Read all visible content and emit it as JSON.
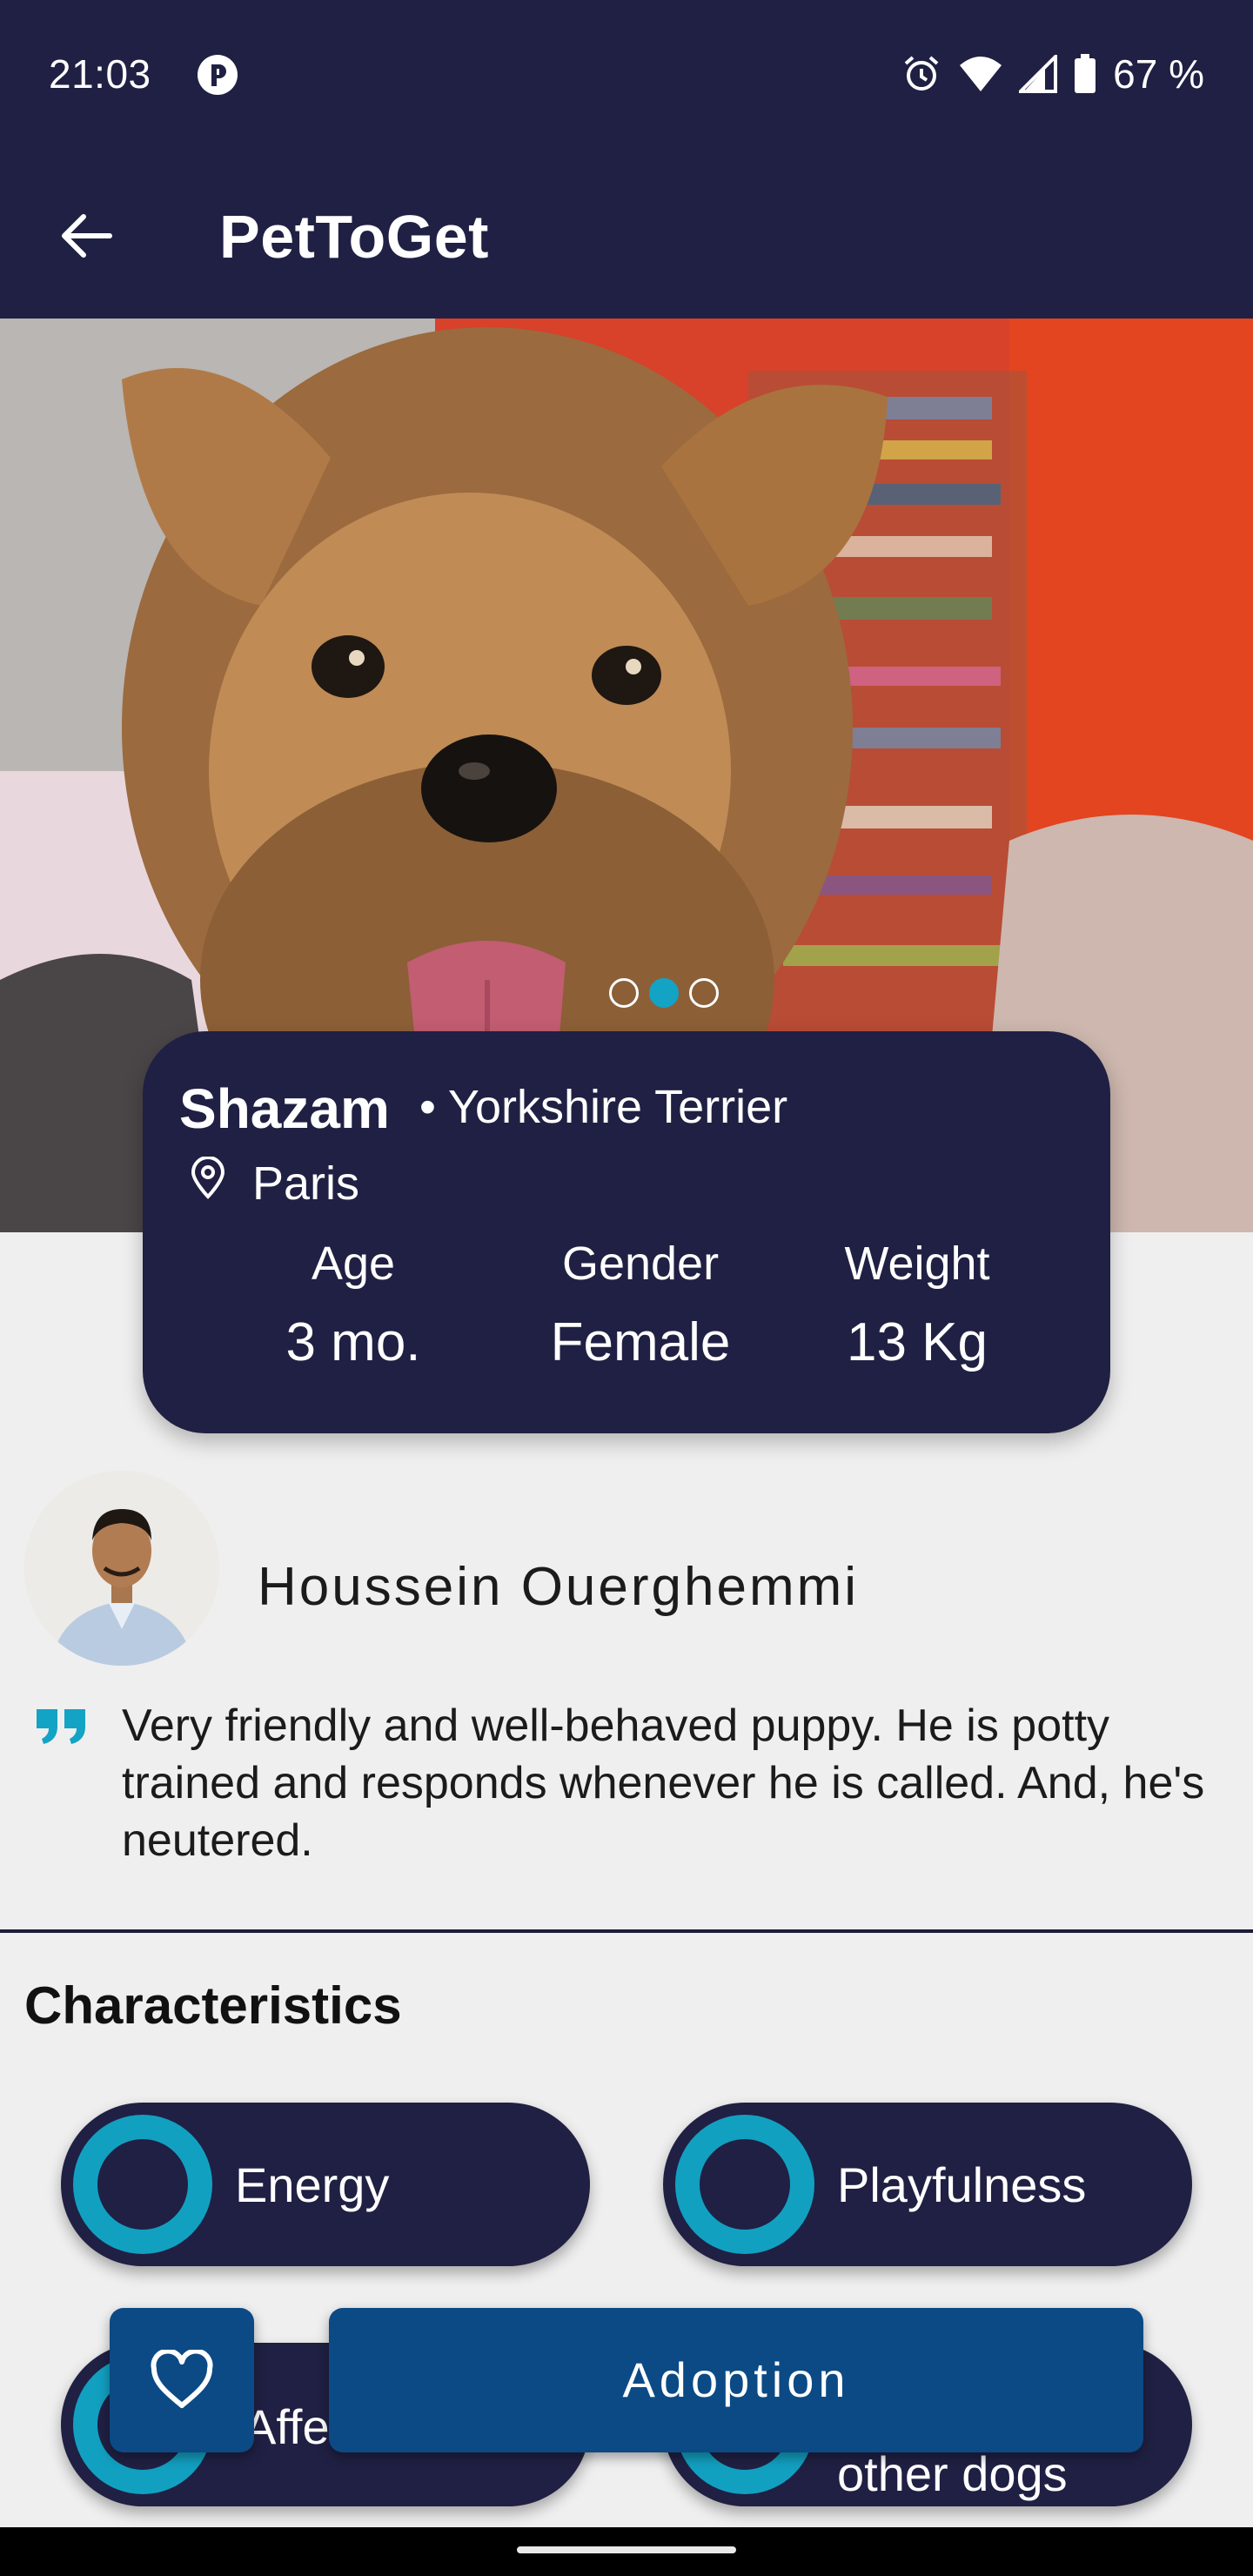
{
  "status_bar": {
    "time": "21:03",
    "battery": "67 %"
  },
  "app_bar": {
    "title": "PetToGet"
  },
  "carousel": {
    "pages": 3,
    "active_index": 1
  },
  "pet": {
    "name": "Shazam",
    "breed": "• Yorkshire Terrier",
    "city": "Paris",
    "stats": [
      {
        "label": "Age",
        "value": "3 mo."
      },
      {
        "label": "Gender",
        "value": "Female"
      },
      {
        "label": "Weight",
        "value": "13 Kg"
      }
    ]
  },
  "owner": {
    "name": "Houssein Ouerghemmi"
  },
  "description": "Very friendly and well-behaved puppy. He is potty trained and responds whenever he is called. And, he's neutered.",
  "characteristics": {
    "title": "Characteristics",
    "items": [
      "Energy",
      "Playfulness",
      "Affe",
      "other dogs"
    ]
  },
  "actions": {
    "adopt_label": "Adoption"
  },
  "colors": {
    "primary": "#202044",
    "accent": "#12a0c1",
    "button": "#0b4a85",
    "background": "#efefef"
  },
  "icons": [
    "p-status-icon",
    "alarm-icon",
    "wifi-icon",
    "signal-icon",
    "battery-icon",
    "back-arrow-icon",
    "location-pin-icon",
    "quote-icon",
    "heart-icon"
  ]
}
